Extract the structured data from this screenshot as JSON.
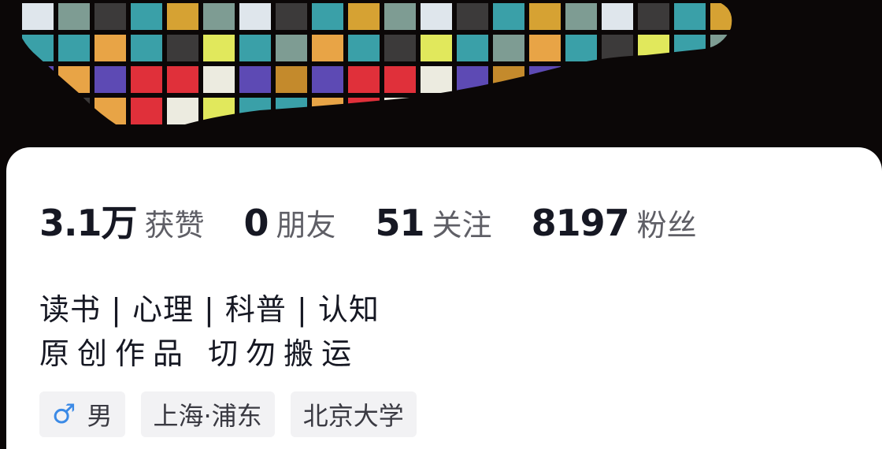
{
  "banner": {
    "tile_colors": {
      "teal": "#3aa0a8",
      "mustard": "#d6a233",
      "gray": "#7e9c93",
      "pale": "#dfe6ec",
      "dark": "#3c3a3a",
      "yellow": "#e1e85c",
      "orange": "#e8a446",
      "purple": "#5d4ab4",
      "red": "#e0303a",
      "cream": "#ecebe0",
      "ochre": "#c48a2c"
    }
  },
  "profile": {
    "stats": [
      {
        "value": "3.1万",
        "label": "获赞"
      },
      {
        "value": "0",
        "label": "朋友"
      },
      {
        "value": "51",
        "label": "关注"
      },
      {
        "value": "8197",
        "label": "粉丝"
      }
    ],
    "bio": {
      "line1": "读书 | 心理 | 科普 | 认知",
      "line2": "原创作品 切勿搬运"
    },
    "tags": {
      "gender_icon": "♂",
      "gender": "男",
      "location": "上海·浦东",
      "school": "北京大学"
    }
  }
}
